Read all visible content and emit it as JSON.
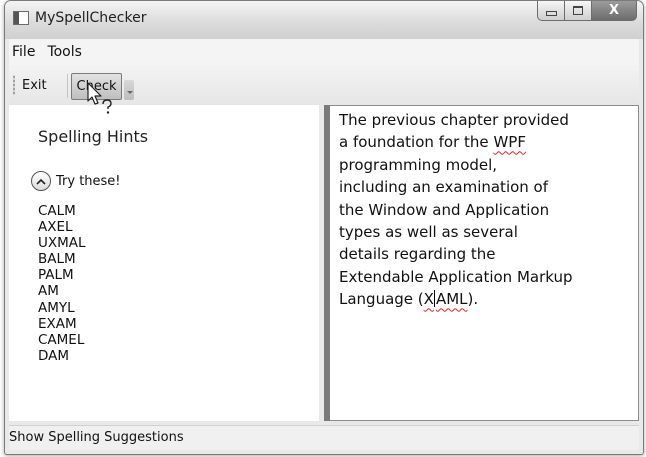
{
  "window": {
    "title": "MySpellChecker",
    "close_glyph": "X"
  },
  "menu": {
    "items": [
      {
        "label": "File"
      },
      {
        "label": "Tools"
      }
    ]
  },
  "toolbar": {
    "exit_label": "Exit",
    "check_label": "Check"
  },
  "hints": {
    "title": "Spelling Hints",
    "expander_label": "Try these!",
    "suggestions": [
      "CALM",
      "AXEL",
      "UXMAL",
      "BALM",
      "PALM",
      "AM",
      "AMYL",
      "EXAM",
      "CAMEL",
      "DAM"
    ]
  },
  "editor": {
    "lines": [
      {
        "pre": "The previous chapter provided",
        "word": "",
        "post": ""
      },
      {
        "pre": "a foundation for the ",
        "word": "WPF",
        "post": ""
      },
      {
        "pre": "programming model,",
        "word": "",
        "post": ""
      },
      {
        "pre": "including an examination of",
        "word": "",
        "post": ""
      },
      {
        "pre": "the Window and Application",
        "word": "",
        "post": ""
      },
      {
        "pre": "types as well as several",
        "word": "",
        "post": ""
      },
      {
        "pre": "details regarding the",
        "word": "",
        "post": ""
      },
      {
        "pre": "Extendable Application Markup",
        "word": "",
        "post": ""
      },
      {
        "pre": "Language (",
        "word": "XAML",
        "post": ")."
      }
    ]
  },
  "status": {
    "text": "Show Spelling Suggestions"
  },
  "icons": {
    "app": "app-icon",
    "cursor": "help-select-cursor-icon",
    "expander": "chevron-up-icon"
  }
}
